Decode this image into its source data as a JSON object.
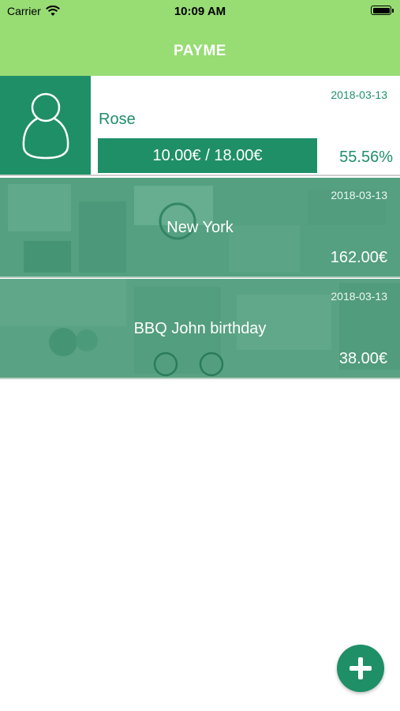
{
  "status_bar": {
    "carrier": "Carrier",
    "time": "10:09 AM"
  },
  "nav": {
    "title": "PAYME"
  },
  "colors": {
    "bar": "#98dc74",
    "accent": "#1f8f68"
  },
  "person": {
    "date": "2018-03-13",
    "name": "Rose",
    "paid_total": "10.00€ / 18.00€",
    "percent": "55.56%",
    "avatar_icon": "person-icon"
  },
  "trips": [
    {
      "date": "2018-03-13",
      "name": "New York",
      "amount": "162.00€"
    },
    {
      "date": "2018-03-13",
      "name": "BBQ John birthday",
      "amount": "38.00€"
    }
  ],
  "fab": {
    "icon": "plus-icon"
  }
}
